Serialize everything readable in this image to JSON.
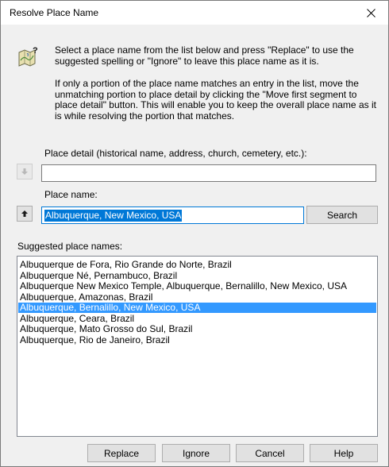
{
  "window": {
    "title": "Resolve Place Name"
  },
  "description": {
    "paragraph1": "Select a place name from the list below and press \"Replace\" to use the suggested spelling or \"Ignore\" to leave this place name as it is.",
    "paragraph2": "If only a portion of the place name matches an entry in the list, move the unmatching portion to place detail by clicking the \"Move first segment to place detail\" button. This will enable you to keep the overall place name as it is while resolving the portion that matches."
  },
  "place_detail": {
    "label": "Place detail (historical name, address, church, cemetery, etc.):",
    "value": ""
  },
  "place_name": {
    "label": "Place name:",
    "value": "Albuquerque, New Mexico, USA"
  },
  "search_button": {
    "label": "Search"
  },
  "suggestions": {
    "label": "Suggested place names:",
    "items": [
      "Albuquerque de Fora, Rio Grande do Norte, Brazil",
      "Albuquerque Né, Pernambuco, Brazil",
      "Albuquerque New Mexico Temple, Albuquerque, Bernalillo, New Mexico, USA",
      "Albuquerque, Amazonas, Brazil",
      "Albuquerque, Bernalillo, New Mexico, USA",
      "Albuquerque, Ceara, Brazil",
      "Albuquerque, Mato Grosso do Sul, Brazil",
      "Albuquerque, Rio de Janeiro, Brazil"
    ],
    "selected_index": 4
  },
  "footer": {
    "replace": "Replace",
    "ignore": "Ignore",
    "cancel": "Cancel",
    "help": "Help"
  },
  "icons": {
    "dialog_icon": "map-question-icon",
    "move_down": "arrow-down-icon",
    "move_up": "arrow-up-icon",
    "close": "close-icon"
  },
  "colors": {
    "selection": "#3399ff",
    "focus_border": "#0078d7",
    "text_selection": "#0078d7"
  }
}
